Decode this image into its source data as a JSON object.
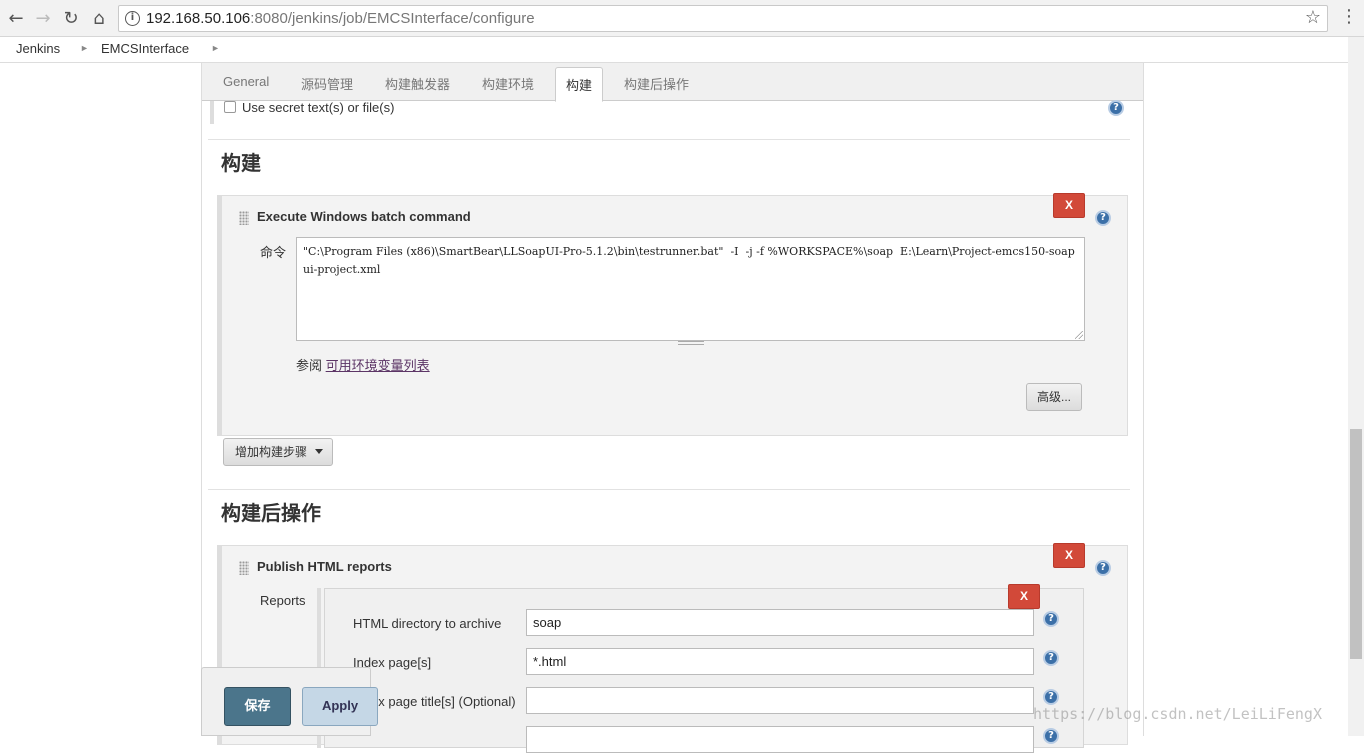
{
  "browser": {
    "url_host": "192.168.50.106",
    "url_rest": ":8080/jenkins/job/EMCSInterface/configure"
  },
  "breadcrumb": [
    "Jenkins",
    "EMCSInterface"
  ],
  "tabs": [
    {
      "label": "General",
      "active": false
    },
    {
      "label": "源码管理",
      "active": false
    },
    {
      "label": "构建触发器",
      "active": false
    },
    {
      "label": "构建环境",
      "active": false
    },
    {
      "label": "构建",
      "active": true
    },
    {
      "label": "构建后操作",
      "active": false
    }
  ],
  "build_env": {
    "secret_checkbox_label": "Use secret text(s) or file(s)",
    "checked": false
  },
  "build": {
    "section_title": "构建",
    "step_title": "Execute Windows batch command",
    "delete_label": "X",
    "command_label": "命令",
    "command_value": "\"C:\\Program Files (x86)\\SmartBear\\LLSoapUI-Pro-5.1.2\\bin\\testrunner.bat\"  -I  -j -f %WORKSPACE%\\soap  E:\\Learn\\Project-emcs150-soapui-project.xml",
    "see_also_prefix": "参阅",
    "see_also_link": "可用环境变量列表",
    "advanced_button": "高级...",
    "add_step_button": "增加构建步骤"
  },
  "post_build": {
    "section_title": "构建后操作",
    "step_title": "Publish HTML reports",
    "delete_label": "X",
    "reports_label": "Reports",
    "report_delete_label": "X",
    "fields": [
      {
        "label": "HTML directory to archive",
        "value": "soap"
      },
      {
        "label": "Index page[s]",
        "value": "*.html"
      },
      {
        "label": "Index page title[s] (Optional)",
        "value": ""
      }
    ]
  },
  "footer": {
    "save_label": "保存",
    "apply_label": "Apply"
  },
  "help_label": "?",
  "watermark": "https://blog.csdn.net/LeiLiFengX"
}
